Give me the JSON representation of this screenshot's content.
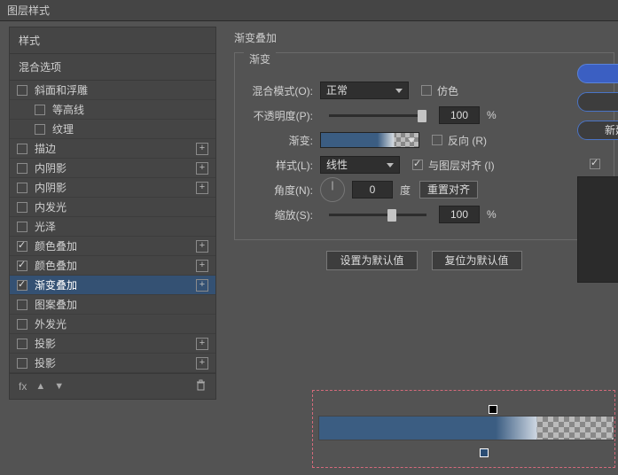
{
  "window": {
    "title": "图层样式"
  },
  "leftPanel": {
    "header1": "样式",
    "header2": "混合选项",
    "items": [
      {
        "label": "斜面和浮雕",
        "checked": false,
        "plus": false,
        "sub": false
      },
      {
        "label": "等高线",
        "checked": false,
        "plus": false,
        "sub": true
      },
      {
        "label": "纹理",
        "checked": false,
        "plus": false,
        "sub": true
      },
      {
        "label": "描边",
        "checked": false,
        "plus": true,
        "sub": false
      },
      {
        "label": "内阴影",
        "checked": false,
        "plus": true,
        "sub": false
      },
      {
        "label": "内阴影",
        "checked": false,
        "plus": true,
        "sub": false
      },
      {
        "label": "内发光",
        "checked": false,
        "plus": false,
        "sub": false
      },
      {
        "label": "光泽",
        "checked": false,
        "plus": false,
        "sub": false
      },
      {
        "label": "颜色叠加",
        "checked": true,
        "plus": true,
        "sub": false
      },
      {
        "label": "颜色叠加",
        "checked": true,
        "plus": true,
        "sub": false
      },
      {
        "label": "渐变叠加",
        "checked": true,
        "plus": true,
        "sub": false,
        "selected": true
      },
      {
        "label": "图案叠加",
        "checked": false,
        "plus": false,
        "sub": false
      },
      {
        "label": "外发光",
        "checked": false,
        "plus": false,
        "sub": false
      },
      {
        "label": "投影",
        "checked": false,
        "plus": true,
        "sub": false
      },
      {
        "label": "投影",
        "checked": false,
        "plus": true,
        "sub": false
      }
    ],
    "footer": {
      "fx": "fx"
    }
  },
  "section": {
    "title": "渐变叠加",
    "group": "渐变",
    "blendModeLabel": "混合模式(O):",
    "blendModeValue": "正常",
    "ditherLabel": "仿色",
    "ditherChecked": false,
    "opacityLabel": "不透明度(P):",
    "opacityValue": "100",
    "opacityUnit": "%",
    "gradientLabel": "渐变:",
    "reverseLabel": "反向 (R)",
    "reverseChecked": false,
    "styleLabel": "样式(L):",
    "styleValue": "线性",
    "alignLabel": "与图层对齐 (I)",
    "alignChecked": true,
    "angleLabel": "角度(N):",
    "angleValue": "0",
    "angleUnit": "度",
    "resetAlign": "重置对齐",
    "scaleLabel": "缩放(S):",
    "scaleValue": "100",
    "scaleUnit": "%",
    "defaultsBtn": "设置为默认值",
    "resetBtn": "复位为默认值"
  },
  "rightBtns": {
    "new": "新建"
  },
  "preview": {
    "checked": true
  }
}
